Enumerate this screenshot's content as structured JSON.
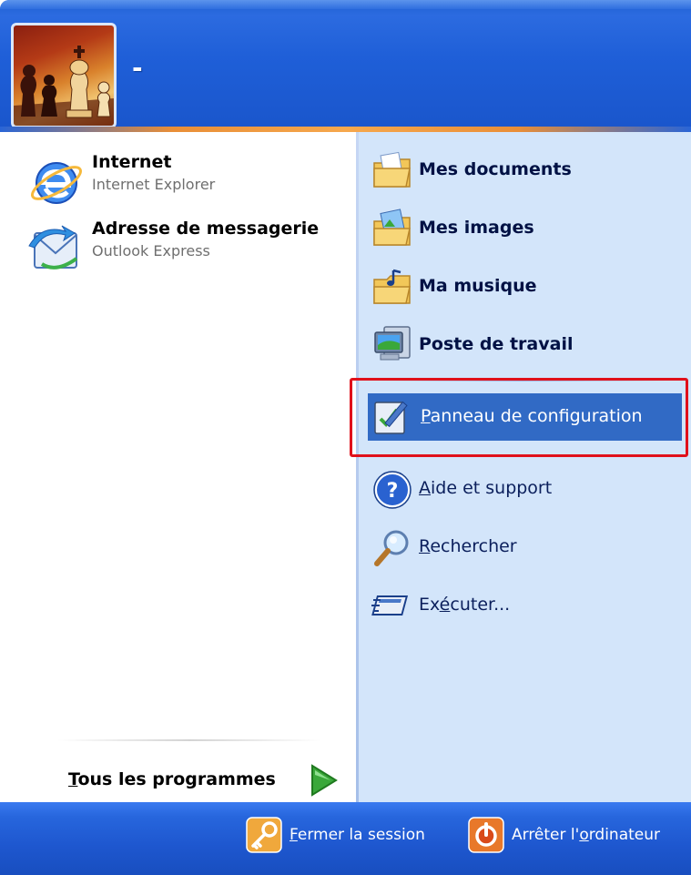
{
  "header": {
    "username": "-",
    "avatar_icon": "chess-pieces-avatar"
  },
  "pinned": [
    {
      "title": "Internet",
      "subtitle": "Internet Explorer",
      "icon": "internet-explorer-icon"
    },
    {
      "title": "Adresse de messagerie",
      "subtitle": "Outlook Express",
      "icon": "outlook-express-icon"
    }
  ],
  "all_programs": {
    "label_accel": "T",
    "label_rest": "ous les programmes",
    "icon": "green-arrow-icon"
  },
  "places": [
    {
      "label": "Mes documents",
      "icon": "my-documents-folder-icon"
    },
    {
      "label": "Mes images",
      "icon": "my-pictures-folder-icon"
    },
    {
      "label": "Ma musique",
      "icon": "my-music-folder-icon"
    },
    {
      "label": "Poste de travail",
      "icon": "my-computer-icon"
    }
  ],
  "control_panel": {
    "accel": "P",
    "rest": "anneau de configuration",
    "icon": "control-panel-icon",
    "state": "highlighted"
  },
  "tools": [
    {
      "accel": "A",
      "rest": "ide et support",
      "icon": "help-icon"
    },
    {
      "accel": "R",
      "rest": "echercher",
      "icon": "search-icon"
    },
    {
      "pre": "Ex",
      "accel": "é",
      "rest": "cuter...",
      "icon": "run-icon"
    }
  ],
  "footer": {
    "logoff": {
      "accel": "F",
      "rest": "ermer la session",
      "icon": "key-icon"
    },
    "shutdown": {
      "pre": "Arrêter l'",
      "accel": "o",
      "rest": "rdinateur",
      "icon": "power-icon"
    }
  },
  "colors": {
    "header_blue": "#1f5fd8",
    "right_panel": "#d3e5fa",
    "highlight": "#316ac5",
    "annotation_red": "#e0101a",
    "accent_orange": "#f6a84d"
  }
}
